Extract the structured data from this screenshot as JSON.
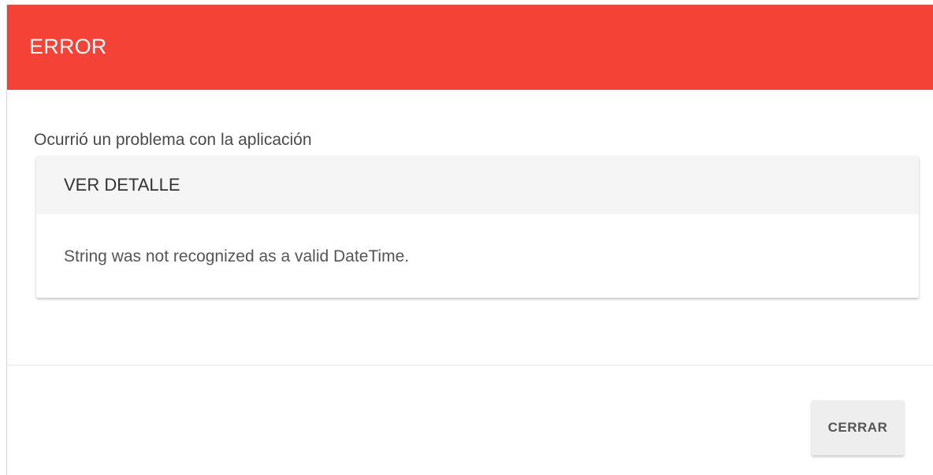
{
  "dialog": {
    "title": "ERROR",
    "message": "Ocurrió un problema con la aplicación",
    "detail": {
      "header_label": "VER DETALLE",
      "body_text": "String was not recognized as a valid DateTime."
    },
    "footer": {
      "close_label": "CERRAR"
    }
  },
  "colors": {
    "header_background": "#f44336",
    "header_text": "#ffffff",
    "detail_header_background": "#f5f5f5",
    "button_background": "#eeeeee"
  }
}
